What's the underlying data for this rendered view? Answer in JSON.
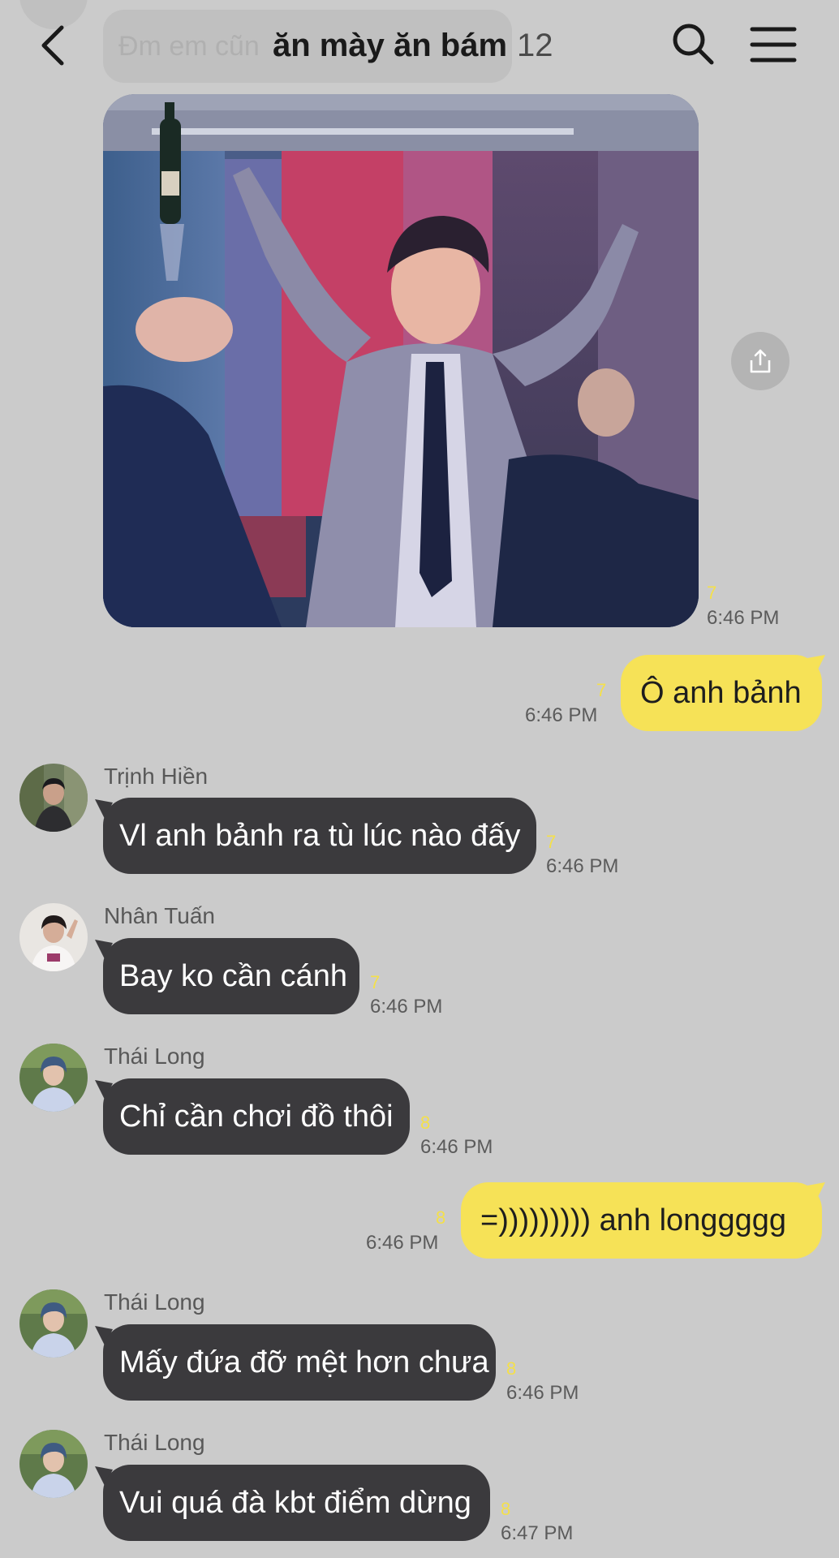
{
  "header": {
    "title": "ăn mày ăn bám",
    "member_count": "12",
    "ghost_preview": "Đm em cũn"
  },
  "colors": {
    "background": "#cbcbcb",
    "incoming_bubble": "#3b3a3d",
    "outgoing_bubble": "#f6e257",
    "unread_count": "#f4e04a"
  },
  "icons": {
    "back": "chevron-left-icon",
    "search": "search-icon",
    "menu": "hamburger-menu-icon",
    "share": "share-icon"
  },
  "messages": [
    {
      "type": "image",
      "direction": "in",
      "unread": "7",
      "time": "6:46 PM"
    },
    {
      "type": "text",
      "direction": "out",
      "text": "Ô anh bảnh",
      "unread": "7",
      "time": "6:46 PM"
    },
    {
      "type": "text",
      "direction": "in",
      "sender": "Trịnh Hiền",
      "text": "Vl anh bảnh ra tù lúc nào đấy",
      "unread": "7",
      "time": "6:46 PM"
    },
    {
      "type": "text",
      "direction": "in",
      "sender": "Nhân Tuấn",
      "text": "Bay ko cần cánh",
      "unread": "7",
      "time": "6:46 PM"
    },
    {
      "type": "text",
      "direction": "in",
      "sender": "Thái Long",
      "text": "Chỉ cần chơi đồ thôi",
      "unread": "8",
      "time": "6:46 PM"
    },
    {
      "type": "text",
      "direction": "out",
      "text": "=))))))))) anh longgggg",
      "unread": "8",
      "time": "6:46 PM"
    },
    {
      "type": "text",
      "direction": "in",
      "sender": "Thái Long",
      "text": "Mấy đứa đỡ mệt hơn chưa",
      "unread": "8",
      "time": "6:46 PM"
    },
    {
      "type": "text",
      "direction": "in",
      "sender": "Thái Long",
      "text": "Vui quá đà kbt điểm dừng",
      "unread": "8",
      "time": "6:47 PM"
    }
  ]
}
